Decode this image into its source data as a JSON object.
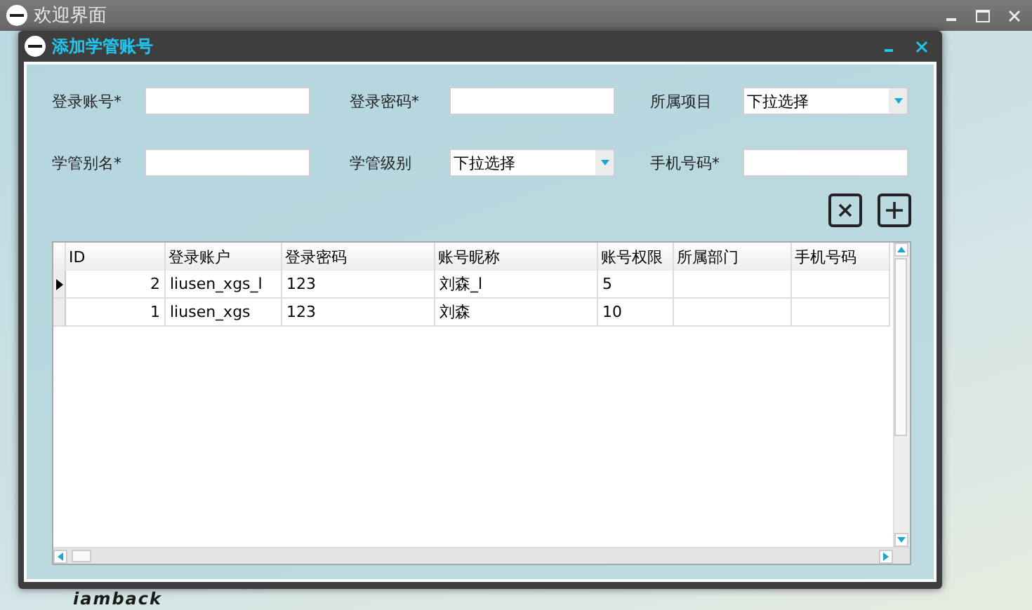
{
  "main_window": {
    "title": "欢迎界面",
    "logo_text": "iamback"
  },
  "dialog": {
    "title": "添加学管账号"
  },
  "form": {
    "fields": [
      {
        "kind": "input",
        "label": "登录账号*"
      },
      {
        "kind": "input",
        "label": "登录密码*"
      },
      {
        "kind": "select",
        "label": "所属项目",
        "value": "下拉选择"
      },
      {
        "kind": "input",
        "label": "学管别名*"
      },
      {
        "kind": "select",
        "label": "学管级别",
        "value": "下拉选择"
      },
      {
        "kind": "input",
        "label": "手机号码*"
      }
    ]
  },
  "table": {
    "columns": [
      "ID",
      "登录账户",
      "登录密码",
      "账号昵称",
      "账号权限",
      "所属部门",
      "手机号码"
    ],
    "rows": [
      {
        "selected": true,
        "cells": [
          "2",
          "liusen_xgs_l",
          "123",
          "刘森_l",
          "5",
          "",
          ""
        ]
      },
      {
        "selected": false,
        "cells": [
          "1",
          "liusen_xgs",
          "123",
          "刘森",
          "10",
          "",
          ""
        ]
      }
    ]
  }
}
